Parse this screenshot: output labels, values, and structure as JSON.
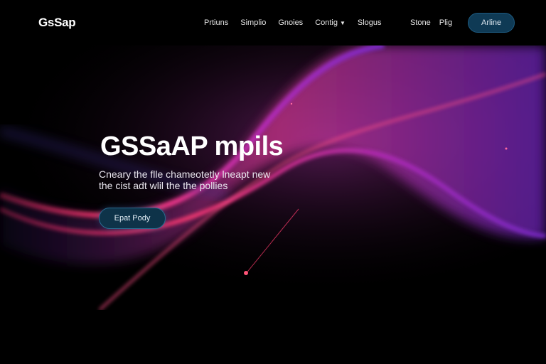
{
  "nav": {
    "logo": "GsSap",
    "items": [
      "Prtiuns",
      "Simplio",
      "Gnoies",
      "Contig",
      "Slogus"
    ],
    "right_links": [
      "Stone",
      "Plig"
    ],
    "action_label": "Arline"
  },
  "hero": {
    "title": "GSSaAP mpils",
    "description": [
      "Cneary the flle chameotetly lneapt new",
      "the cist adt wlil the the pollies"
    ],
    "cta_label": "Epat Pody"
  },
  "colors": {
    "background": "#000000",
    "wave_pink": "#ff3f7a",
    "wave_purple": "#8e2bd6",
    "button_fill": "#0f3a55"
  }
}
